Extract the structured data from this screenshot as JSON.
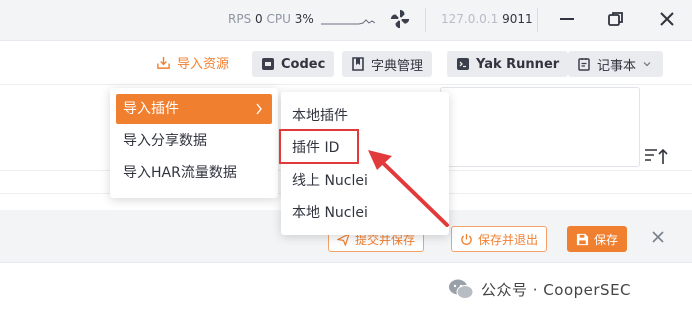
{
  "titlebar": {
    "rps_label": "RPS",
    "rps_value": "0",
    "cpu_label": "CPU",
    "cpu_value": "3%",
    "ip": "127.0.0.1",
    "port": "9011"
  },
  "toolbar": {
    "import_label": "导入资源",
    "codec_label": "Codec",
    "dict_label": "字典管理",
    "runner_label": "Yak Runner",
    "notepad_label": "记事本"
  },
  "import_menu": {
    "items": [
      {
        "label": "导入插件",
        "active": true,
        "has_submenu": true
      },
      {
        "label": "导入分享数据"
      },
      {
        "label": "导入HAR流量数据"
      }
    ]
  },
  "plugin_submenu": {
    "items": [
      {
        "label": "本地插件"
      },
      {
        "label": "插件 ID",
        "highlighted": true
      },
      {
        "label": "线上 Nuclei"
      },
      {
        "label": "本地 Nuclei"
      }
    ]
  },
  "actions": {
    "submit_save": "提交并保存",
    "save_exit": "保存并退出",
    "save": "保存"
  },
  "watermark": {
    "text": "公众号 · CooperSEC"
  },
  "colors": {
    "accent": "#f17f30",
    "annotation": "#e23a3a"
  },
  "icons": {
    "pinwheel": "pinwheel-icon",
    "minimize": "minimize-icon",
    "restore": "restore-icon",
    "close": "close-icon",
    "import": "import-icon",
    "codec": "codec-icon",
    "dict": "dictionary-icon",
    "runner": "terminal-icon",
    "notepad": "notepad-icon",
    "sort": "sort-icon"
  }
}
